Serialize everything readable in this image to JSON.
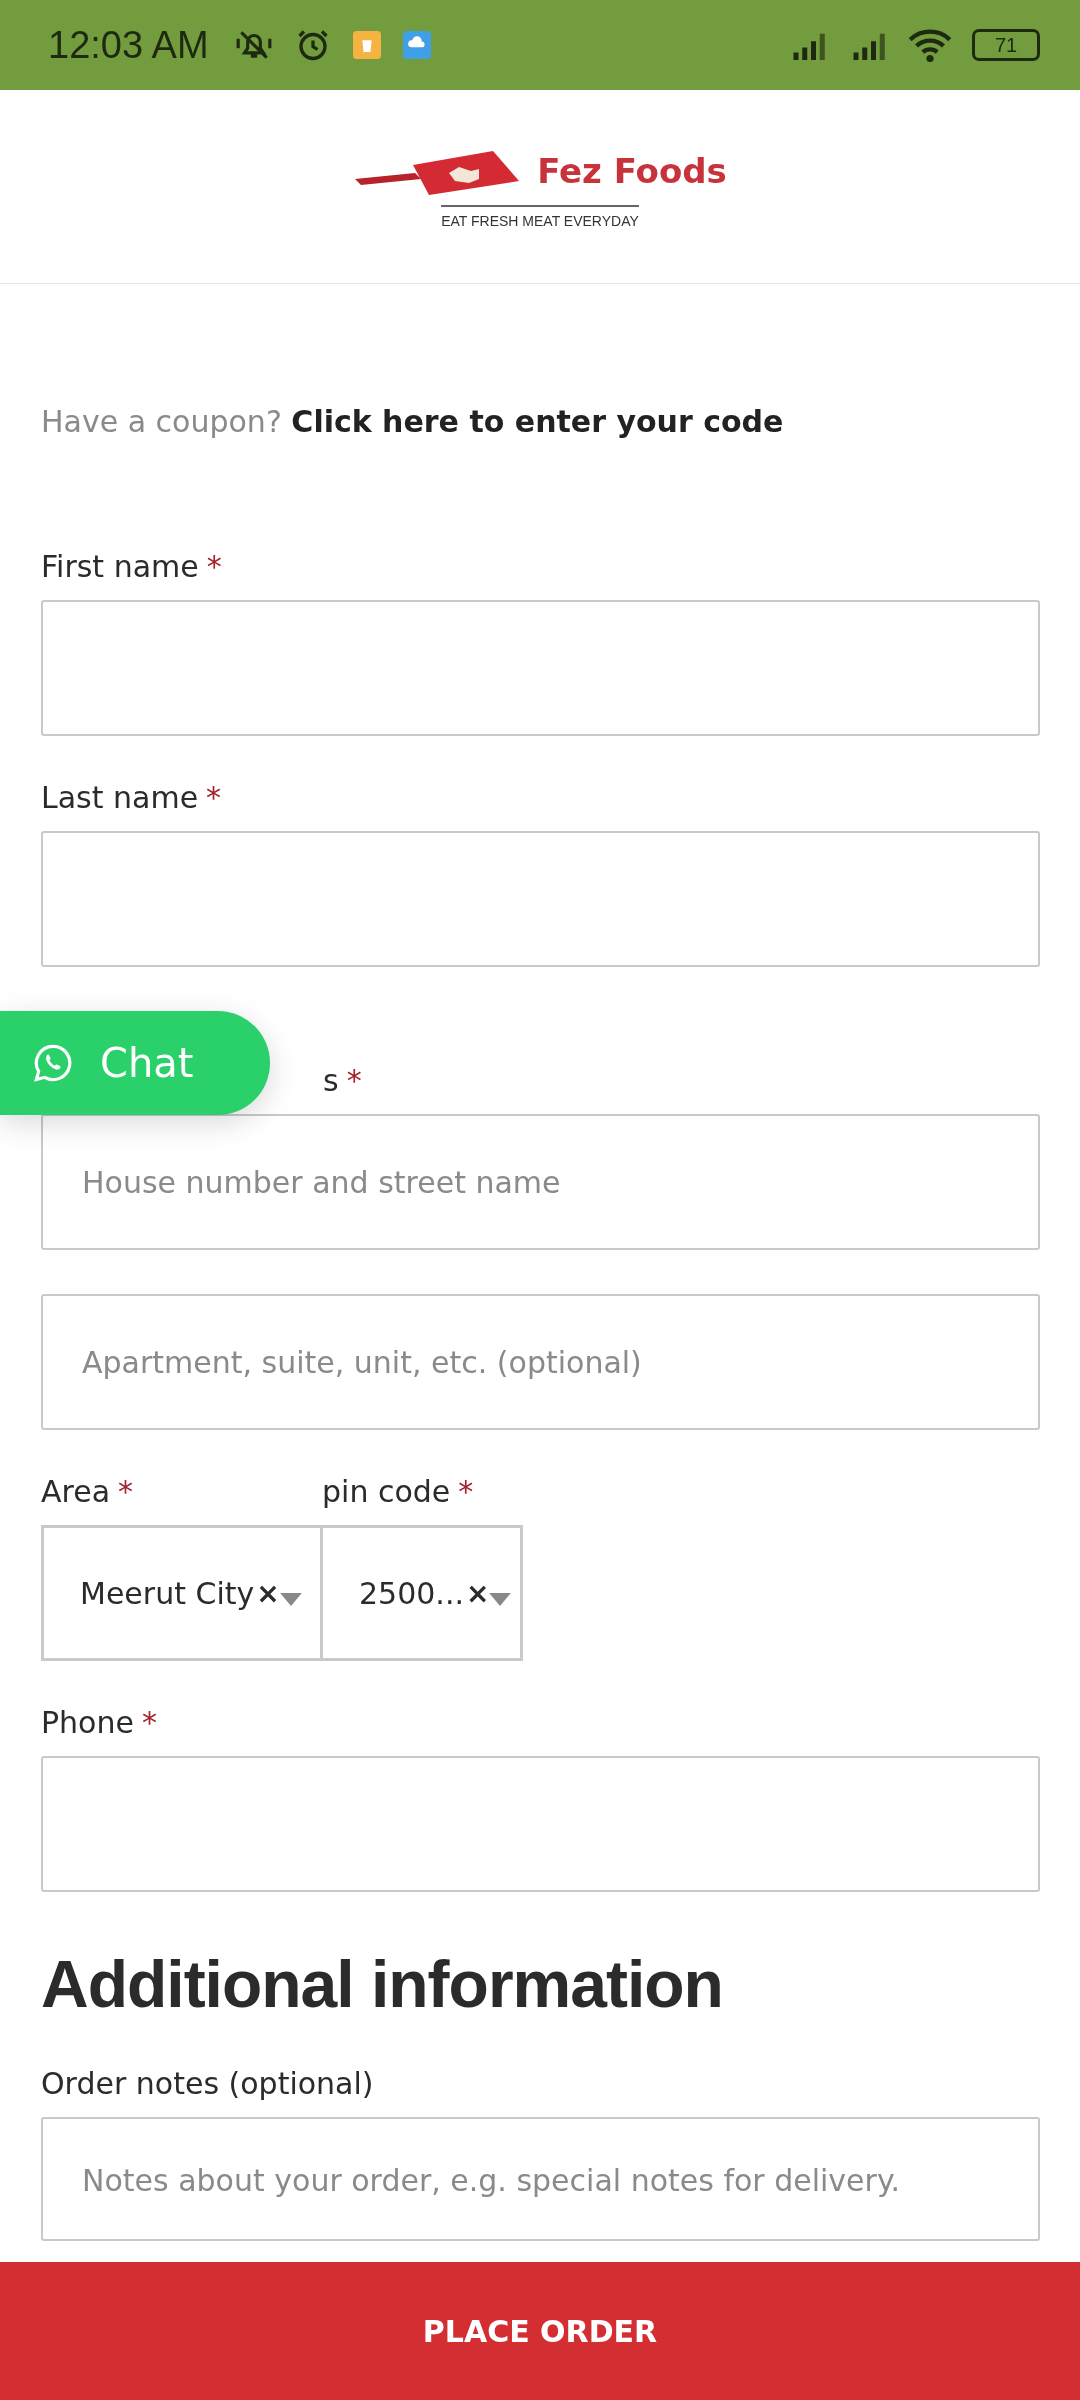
{
  "status_bar": {
    "time": "12:03 AM",
    "battery": "71"
  },
  "header": {
    "brand": "Fez Foods",
    "tagline": "EAT FRESH MEAT EVERYDAY"
  },
  "coupon": {
    "prompt": "Have a coupon?",
    "link": "Click here to enter your code"
  },
  "fields": [
    {
      "kind": "text",
      "label": "First name",
      "required_mark": "*"
    },
    {
      "kind": "text",
      "label": "Last name",
      "required_mark": "*"
    },
    {
      "kind": "covered",
      "label": "s",
      "required_mark": "*",
      "placeholder": "House number and street name"
    },
    {
      "kind": "text",
      "placeholder": "Apartment, suite, unit, etc. (optional)"
    },
    {
      "kind": "selects",
      "items": [
        {
          "label": "Area",
          "required_mark": "*",
          "value": "Meerut City",
          "clear": "×"
        },
        {
          "label": "pin code",
          "required_mark": "*",
          "value": "2500...",
          "clear": "×"
        }
      ]
    },
    {
      "kind": "text",
      "label": "Phone",
      "required_mark": "*"
    }
  ],
  "section_title": "Additional information",
  "notes": {
    "label": "Order notes (optional)",
    "placeholder": "Notes about your order, e.g. special notes for delivery."
  },
  "chat_button": {
    "label": "Chat"
  },
  "place_order": {
    "label": "PLACE ORDER"
  }
}
